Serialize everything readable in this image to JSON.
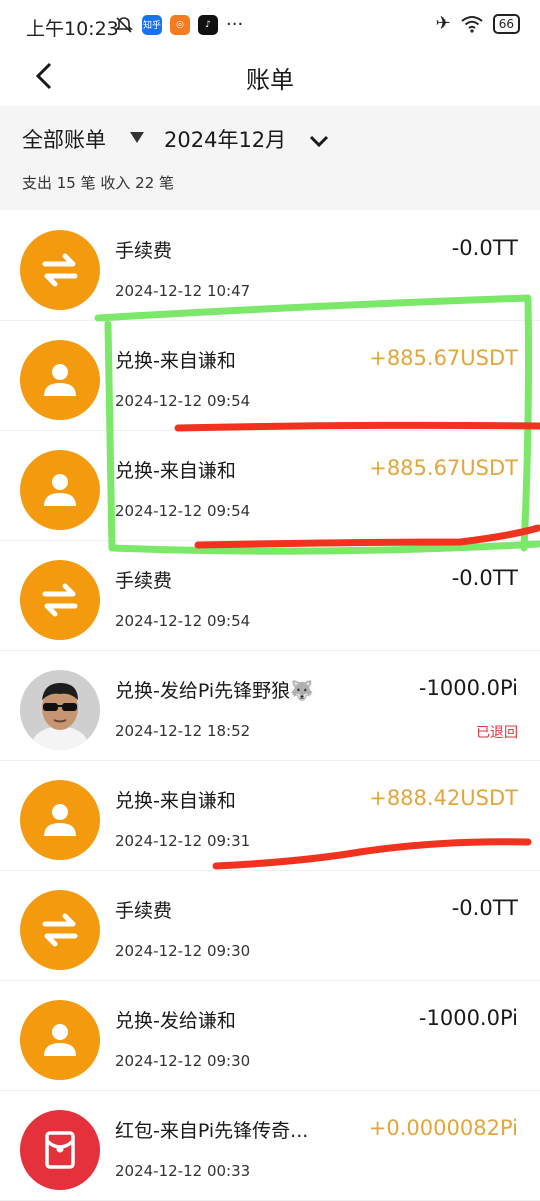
{
  "status_bar": {
    "time": "上午10:23",
    "battery": "66",
    "app_zhihu": "知乎"
  },
  "header": {
    "title": "账单"
  },
  "filter": {
    "category": "全部账单",
    "month": "2024年12月",
    "counts": "支出 15 笔   收入 22 笔"
  },
  "transactions": [
    {
      "title": "手续费",
      "time": "2024-12-12 10:47",
      "amount": "-0.0TT",
      "icon": "swap-icon"
    },
    {
      "title": "兑换-来自谦和",
      "time": "2024-12-12 09:54",
      "amount": "+885.67USDT",
      "icon": "person-icon"
    },
    {
      "title": "兑换-来自谦和",
      "time": "2024-12-12 09:54",
      "amount": "+885.67USDT",
      "icon": "person-icon"
    },
    {
      "title": "手续费",
      "time": "2024-12-12 09:54",
      "amount": "-0.0TT",
      "icon": "swap-icon"
    },
    {
      "title": "兑换-发给Pi先锋野狼🐺",
      "time": "2024-12-12 18:52",
      "amount": "-1000.0Pi",
      "status": "已退回",
      "icon": "user-photo-avatar"
    },
    {
      "title": "兑换-来自谦和",
      "time": "2024-12-12 09:31",
      "amount": "+888.42USDT",
      "icon": "person-icon"
    },
    {
      "title": "手续费",
      "time": "2024-12-12 09:30",
      "amount": "-0.0TT",
      "icon": "swap-icon"
    },
    {
      "title": "兑换-发给谦和",
      "time": "2024-12-12 09:30",
      "amount": "-1000.0Pi",
      "icon": "person-icon"
    },
    {
      "title": "红包-来自Pi先锋传奇...",
      "time": "2024-12-12 00:33",
      "amount": "+0.0000082Pi",
      "icon": "red-packet-icon"
    }
  ],
  "colors": {
    "orange_avatar": "#f39a0f",
    "positive_amount": "#e4a53a",
    "refund_status": "#d9363e",
    "red_packet": "#e5313c",
    "annotation_green": "#7be86a",
    "annotation_red": "#f0321e"
  }
}
